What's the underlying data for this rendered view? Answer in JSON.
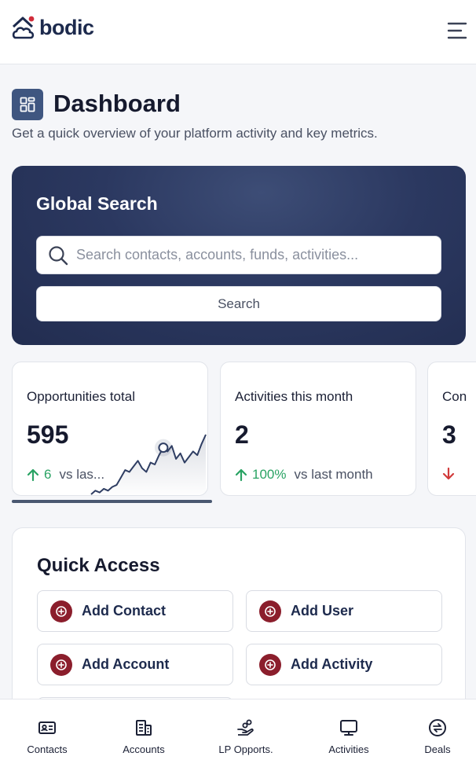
{
  "app": {
    "logo_text": "bodic",
    "menu_icon": "hamburger-menu-icon"
  },
  "page": {
    "title": "Dashboard",
    "title_icon": "dashboard-grid-icon",
    "subtitle": "Get a quick overview of your platform activity and key metrics."
  },
  "search": {
    "title": "Global Search",
    "placeholder": "Search contacts, accounts, funds, activities...",
    "value": "",
    "button_label": "Search"
  },
  "metrics": [
    {
      "label": "Opportunities total",
      "value": "595",
      "delta": "6",
      "direction": "up",
      "note": "vs las...",
      "sparkline": [
        1,
        3,
        2,
        4,
        3,
        5,
        6,
        10,
        14,
        13,
        16,
        19,
        15,
        13,
        18,
        17,
        22,
        26,
        24,
        27,
        20,
        23,
        18,
        21,
        24,
        22,
        28,
        33
      ]
    },
    {
      "label": "Activities this month",
      "value": "2",
      "delta": "100%",
      "direction": "up",
      "note": "vs last month"
    },
    {
      "label": "Con",
      "value": "3",
      "delta": "",
      "direction": "down",
      "note": ""
    }
  ],
  "quick_access": {
    "title": "Quick Access",
    "items": [
      {
        "label": "Add Contact"
      },
      {
        "label": "Add User"
      },
      {
        "label": "Add Account"
      },
      {
        "label": "Add Activity"
      }
    ]
  },
  "bottom_nav": [
    {
      "label": "Contacts",
      "icon": "contact-card-icon"
    },
    {
      "label": "Accounts",
      "icon": "building-icon"
    },
    {
      "label": "LP Opports.",
      "icon": "hand-coins-icon"
    },
    {
      "label": "Activities",
      "icon": "monitor-icon"
    },
    {
      "label": "Deals",
      "icon": "exchange-circle-icon"
    }
  ],
  "colors": {
    "brand_navy": "#1d2a4d",
    "accent_red": "#8b1e2c",
    "up_green": "#2aa364",
    "down_red": "#d13b3b",
    "search_card": "#2b3860"
  }
}
